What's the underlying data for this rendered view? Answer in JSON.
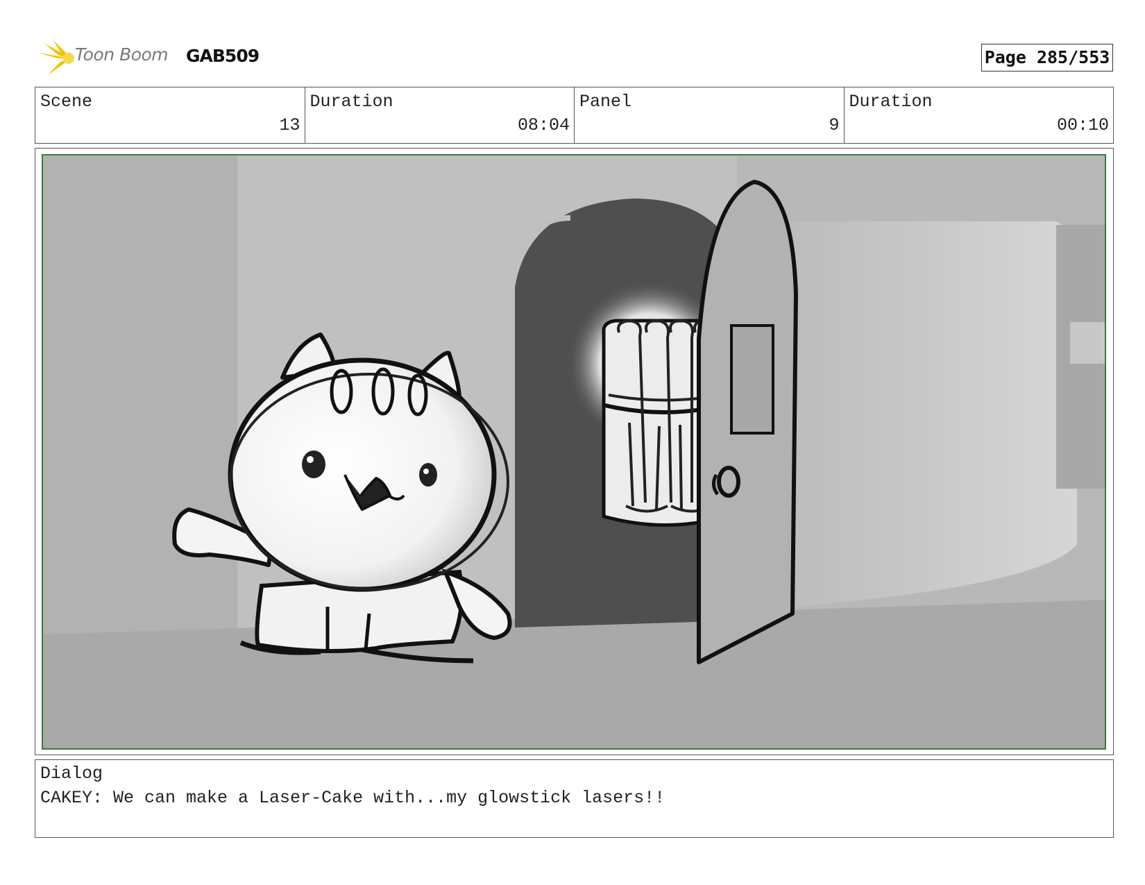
{
  "header": {
    "brand": "Toon Boom",
    "project_id": "GAB509",
    "page_label": "Page 285/553"
  },
  "info": {
    "scene_label": "Scene",
    "scene_value": "13",
    "scene_duration_label": "Duration",
    "scene_duration_value": "08:04",
    "panel_label": "Panel",
    "panel_value": "9",
    "panel_duration_label": "Duration",
    "panel_duration_value": "00:10"
  },
  "dialog": {
    "label": "Dialog",
    "text": "CAKEY: We can make a Laser-Cake with...my glowstick lasers!!"
  },
  "colors": {
    "frame_border": "#3a7a3a",
    "logo_yellow": "#f2c200"
  }
}
